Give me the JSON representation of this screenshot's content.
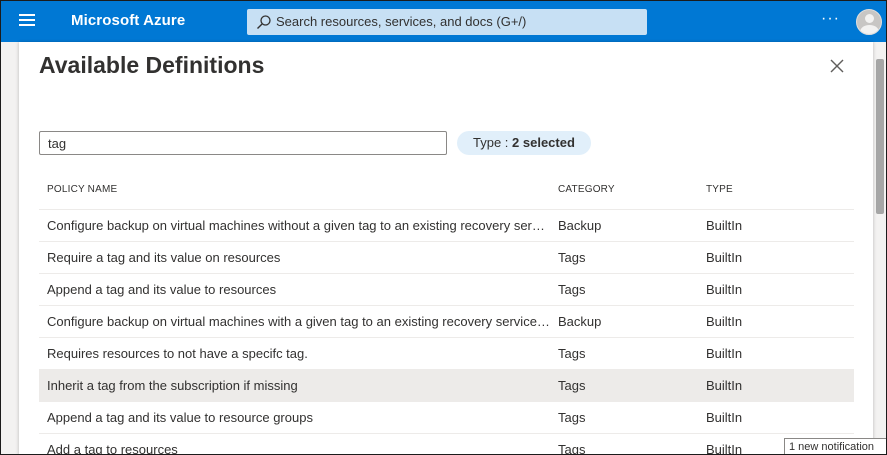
{
  "topbar": {
    "brand": "Microsoft Azure",
    "search_placeholder": "Search resources, services, and docs (G+/)",
    "more": "···"
  },
  "panel": {
    "title": "Available Definitions",
    "filter_value": "tag",
    "type_filter_label": "Type : ",
    "type_filter_value": "2 selected"
  },
  "table": {
    "headers": [
      "POLICY NAME",
      "CATEGORY",
      "TYPE"
    ],
    "rows": [
      {
        "name": "Configure backup on virtual machines without a given tag to an existing recovery services vault",
        "category": "Backup",
        "type": "BuiltIn"
      },
      {
        "name": "Require a tag and its value on resources",
        "category": "Tags",
        "type": "BuiltIn"
      },
      {
        "name": "Append a tag and its value to resources",
        "category": "Tags",
        "type": "BuiltIn"
      },
      {
        "name": "Configure backup on virtual machines with a given tag to an existing recovery services vault",
        "category": "Backup",
        "type": "BuiltIn"
      },
      {
        "name": "Requires resources to not have a specifc tag.",
        "category": "Tags",
        "type": "BuiltIn"
      },
      {
        "name": "Inherit a tag from the subscription if missing",
        "category": "Tags",
        "type": "BuiltIn"
      },
      {
        "name": "Append a tag and its value to resource groups",
        "category": "Tags",
        "type": "BuiltIn"
      },
      {
        "name": "Add a tag to resources",
        "category": "Tags",
        "type": "BuiltIn"
      }
    ]
  },
  "notification": "1 new notification",
  "colors": {
    "topbar": "#0078d4",
    "search_bg": "#c7e0f4",
    "pill_bg": "#e1effa",
    "row_highlight": "#edebe9"
  }
}
